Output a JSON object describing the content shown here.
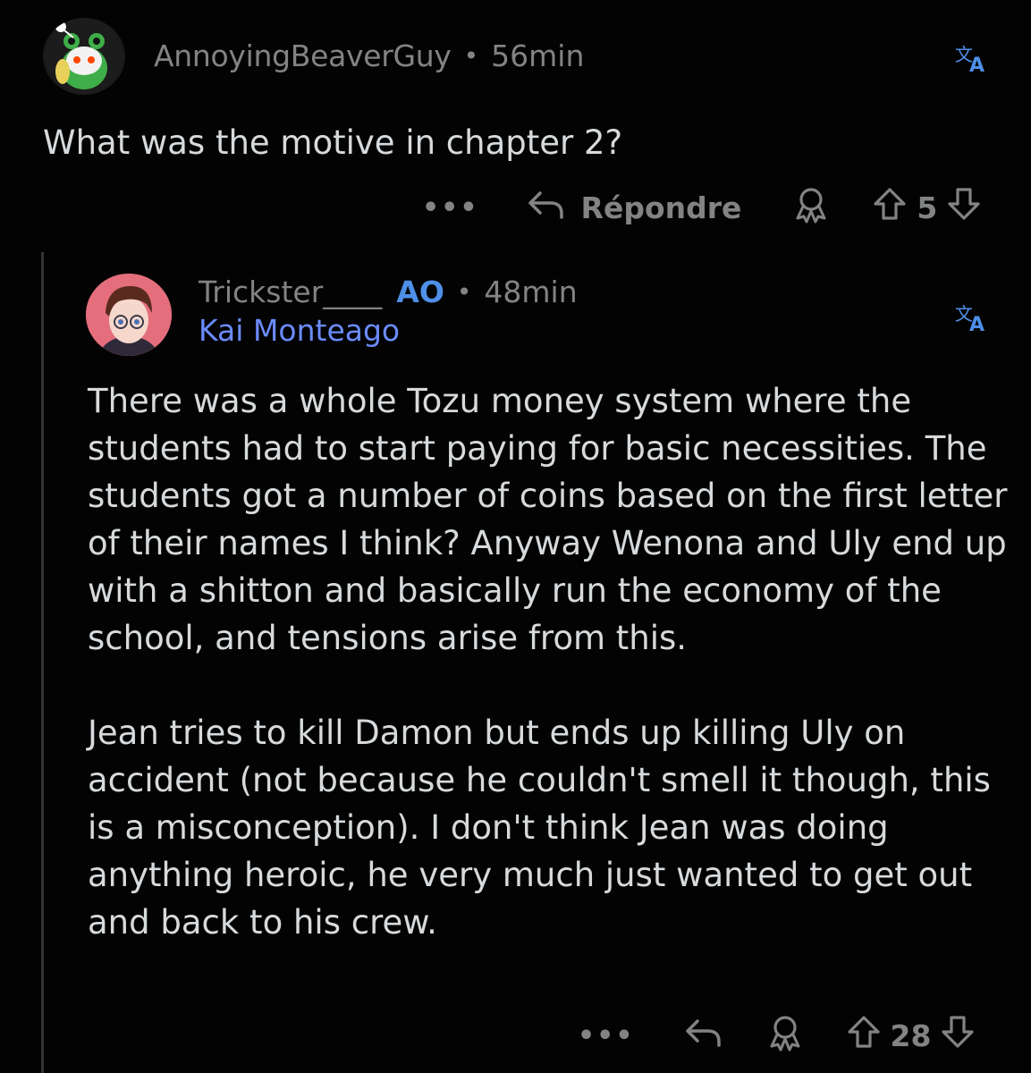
{
  "colors": {
    "background": "#030303",
    "text": "#d7dadc",
    "muted": "#818384",
    "op_badge": "#4f8fe8",
    "flair": "#6b8cff",
    "thread_line": "#343536"
  },
  "comment": {
    "author": "AnnoyingBeaverGuy",
    "separator": "•",
    "time": "56min",
    "body": "What was the motive in chapter 2?",
    "actions": {
      "more_label": "•••",
      "reply_label": "Répondre",
      "score": "5",
      "icons": [
        "reply-icon",
        "award-icon",
        "upvote-icon",
        "downvote-icon",
        "translate-icon"
      ]
    }
  },
  "reply": {
    "author": "Trickster____",
    "op_badge": "AO",
    "separator": "•",
    "time": "48min",
    "flair": "Kai Monteago",
    "paragraphs": [
      "There was a whole Tozu money system where the students had to start paying for basic necessities. The students got a number of coins based on the first letter of their names I think? Anyway Wenona and Uly end up with a shitton and basically run the economy of the school, and tensions arise from this.",
      "Jean tries to kill Damon but ends up killing Uly on accident (not because he couldn't smell it though, this is a misconception). I don't think Jean was doing anything heroic, he very much just wanted to get out and back to his crew."
    ],
    "actions": {
      "more_label": "•••",
      "score": "28"
    }
  }
}
